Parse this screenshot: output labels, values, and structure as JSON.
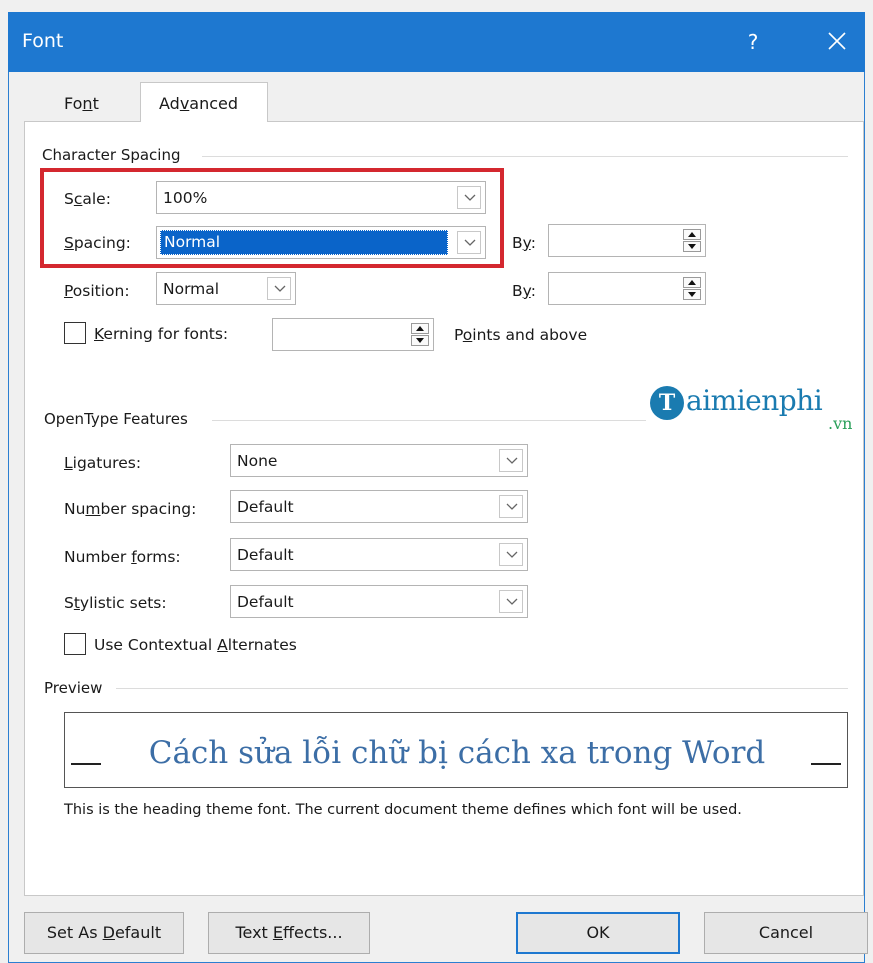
{
  "dialog": {
    "title": "Font",
    "help": "?"
  },
  "tabs": {
    "font": "Font",
    "advanced": "Advanced"
  },
  "character_spacing": {
    "header": "Character Spacing",
    "scale_label": "Scale:",
    "scale_value": "100%",
    "spacing_label": "Spacing:",
    "spacing_value": "Normal",
    "spacing_by_label": "By:",
    "spacing_by_value": "",
    "position_label": "Position:",
    "position_value": "Normal",
    "position_by_label": "By:",
    "position_by_value": "",
    "kerning_label": "Kerning for fonts:",
    "kerning_value": "",
    "points_label": "Points and above"
  },
  "opentype": {
    "header": "OpenType Features",
    "ligatures_label": "Ligatures:",
    "ligatures_value": "None",
    "number_spacing_label": "Number spacing:",
    "number_spacing_value": "Default",
    "number_forms_label": "Number forms:",
    "number_forms_value": "Default",
    "stylistic_sets_label": "Stylistic sets:",
    "stylistic_sets_value": "Default",
    "contextual_label": "Use Contextual Alternates"
  },
  "preview": {
    "header": "Preview",
    "sample_text": "Cách sửa lỗi chữ bị cách xa trong Word",
    "description": "This is the heading theme font. The current document theme defines which font will be used."
  },
  "watermark": {
    "logo_letter": "T",
    "name": "aimienphi",
    "suffix": ".vn"
  },
  "buttons": {
    "set_default": "Set As Default",
    "text_effects": "Text Effects...",
    "ok": "OK",
    "cancel": "Cancel"
  },
  "colors": {
    "titlebar": "#1e78d0",
    "highlight": "#d4282f",
    "selection": "#0a64c9",
    "preview_text": "#3c6ea6"
  }
}
